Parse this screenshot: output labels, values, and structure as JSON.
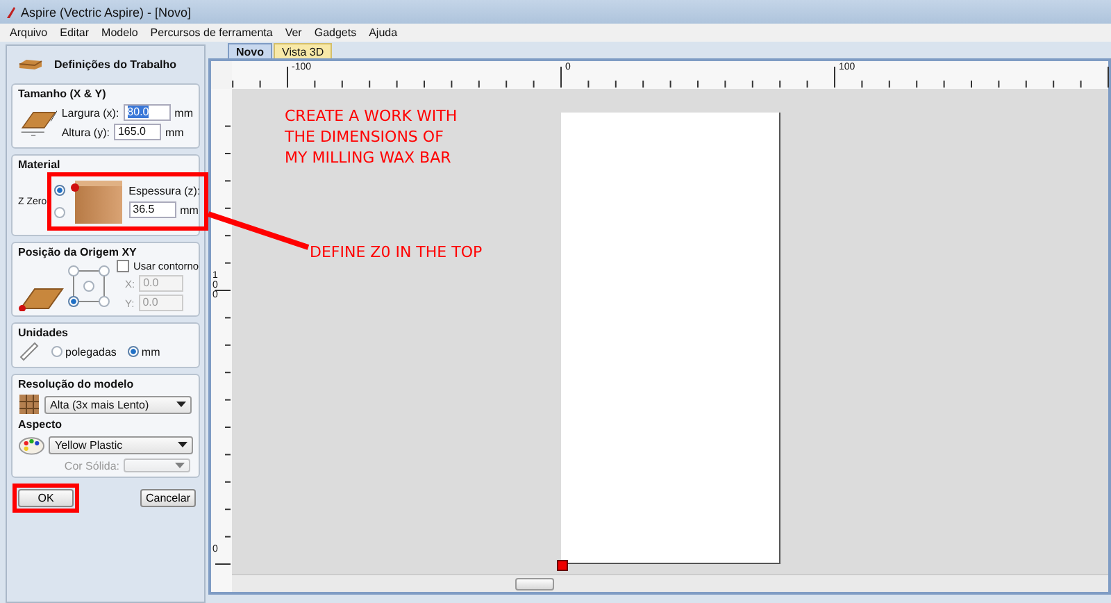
{
  "window": {
    "title": "Aspire (Vectric Aspire) - [Novo]"
  },
  "menu": [
    "Arquivo",
    "Editar",
    "Modelo",
    "Percursos de ferramenta",
    "Ver",
    "Gadgets",
    "Ajuda"
  ],
  "panel": {
    "title": "Definições do Trabalho",
    "size": {
      "heading": "Tamanho (X & Y)",
      "fields": [
        {
          "label": "Largura (x):",
          "value": "80.0",
          "unit": "mm",
          "selected": true
        },
        {
          "label": "Altura (y):",
          "value": "165.0",
          "unit": "mm",
          "selected": false
        }
      ]
    },
    "material": {
      "heading": "Material",
      "z_zero_label": "Z Zero",
      "z_zero_options": [
        {
          "selected": true
        },
        {
          "selected": false
        }
      ],
      "thickness": {
        "label": "Espessura (z):",
        "value": "36.5",
        "unit": "mm"
      }
    },
    "origin": {
      "heading": "Posição da Origem XY",
      "positions": [
        {
          "selected": false
        },
        {
          "selected": false
        },
        {
          "selected": false
        },
        {
          "selected": true
        },
        {
          "selected": false
        }
      ],
      "use_offset": {
        "label": "Usar contorno",
        "checked": false
      },
      "offset_fields": [
        {
          "label": "X:",
          "value": "0.0",
          "disabled": true
        },
        {
          "label": "Y:",
          "value": "0.0",
          "disabled": true
        }
      ]
    },
    "units": {
      "heading": "Unidades",
      "options": [
        {
          "label": "polegadas",
          "selected": false
        },
        {
          "label": "mm",
          "selected": true
        }
      ]
    },
    "resolution": {
      "heading": "Resolução do modelo",
      "value": "Alta (3x mais Lento)"
    },
    "appearance": {
      "heading": "Aspecto",
      "value": "Yellow Plastic",
      "solid_color": {
        "label": "Cor Sólida:",
        "disabled": true
      }
    },
    "buttons": [
      "OK",
      "Cancelar"
    ]
  },
  "tabs": [
    {
      "label": "Novo",
      "selected": true
    },
    {
      "label": "Vista 3D",
      "selected": false
    }
  ],
  "rulers": {
    "horizontal": [
      "-100",
      "0",
      "100"
    ],
    "vertical": [
      "100",
      "0"
    ]
  },
  "annotations": [
    {
      "kind": "note",
      "text": "CREATE A WORK WITH\nTHE DIMENSIONS OF\nMY MILLING WAX BAR"
    },
    {
      "kind": "callout",
      "text": "DEFINE Z0 IN THE TOP"
    }
  ]
}
